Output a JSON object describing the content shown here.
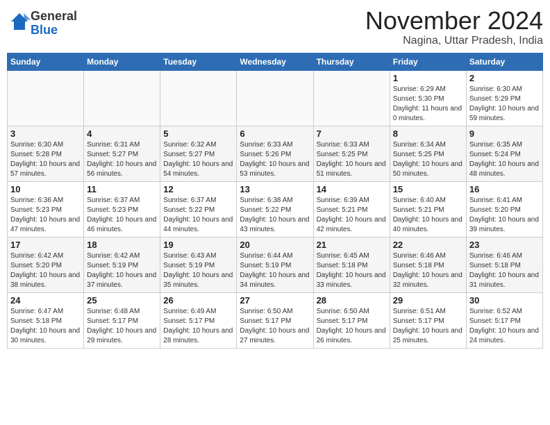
{
  "logo": {
    "general": "General",
    "blue": "Blue"
  },
  "title": "November 2024",
  "subtitle": "Nagina, Uttar Pradesh, India",
  "days_header": [
    "Sunday",
    "Monday",
    "Tuesday",
    "Wednesday",
    "Thursday",
    "Friday",
    "Saturday"
  ],
  "weeks": [
    [
      {
        "day": "",
        "info": ""
      },
      {
        "day": "",
        "info": ""
      },
      {
        "day": "",
        "info": ""
      },
      {
        "day": "",
        "info": ""
      },
      {
        "day": "",
        "info": ""
      },
      {
        "day": "1",
        "info": "Sunrise: 6:29 AM\nSunset: 5:30 PM\nDaylight: 11 hours and 0 minutes."
      },
      {
        "day": "2",
        "info": "Sunrise: 6:30 AM\nSunset: 5:29 PM\nDaylight: 10 hours and 59 minutes."
      }
    ],
    [
      {
        "day": "3",
        "info": "Sunrise: 6:30 AM\nSunset: 5:28 PM\nDaylight: 10 hours and 57 minutes."
      },
      {
        "day": "4",
        "info": "Sunrise: 6:31 AM\nSunset: 5:27 PM\nDaylight: 10 hours and 56 minutes."
      },
      {
        "day": "5",
        "info": "Sunrise: 6:32 AM\nSunset: 5:27 PM\nDaylight: 10 hours and 54 minutes."
      },
      {
        "day": "6",
        "info": "Sunrise: 6:33 AM\nSunset: 5:26 PM\nDaylight: 10 hours and 53 minutes."
      },
      {
        "day": "7",
        "info": "Sunrise: 6:33 AM\nSunset: 5:25 PM\nDaylight: 10 hours and 51 minutes."
      },
      {
        "day": "8",
        "info": "Sunrise: 6:34 AM\nSunset: 5:25 PM\nDaylight: 10 hours and 50 minutes."
      },
      {
        "day": "9",
        "info": "Sunrise: 6:35 AM\nSunset: 5:24 PM\nDaylight: 10 hours and 48 minutes."
      }
    ],
    [
      {
        "day": "10",
        "info": "Sunrise: 6:36 AM\nSunset: 5:23 PM\nDaylight: 10 hours and 47 minutes."
      },
      {
        "day": "11",
        "info": "Sunrise: 6:37 AM\nSunset: 5:23 PM\nDaylight: 10 hours and 46 minutes."
      },
      {
        "day": "12",
        "info": "Sunrise: 6:37 AM\nSunset: 5:22 PM\nDaylight: 10 hours and 44 minutes."
      },
      {
        "day": "13",
        "info": "Sunrise: 6:38 AM\nSunset: 5:22 PM\nDaylight: 10 hours and 43 minutes."
      },
      {
        "day": "14",
        "info": "Sunrise: 6:39 AM\nSunset: 5:21 PM\nDaylight: 10 hours and 42 minutes."
      },
      {
        "day": "15",
        "info": "Sunrise: 6:40 AM\nSunset: 5:21 PM\nDaylight: 10 hours and 40 minutes."
      },
      {
        "day": "16",
        "info": "Sunrise: 6:41 AM\nSunset: 5:20 PM\nDaylight: 10 hours and 39 minutes."
      }
    ],
    [
      {
        "day": "17",
        "info": "Sunrise: 6:42 AM\nSunset: 5:20 PM\nDaylight: 10 hours and 38 minutes."
      },
      {
        "day": "18",
        "info": "Sunrise: 6:42 AM\nSunset: 5:19 PM\nDaylight: 10 hours and 37 minutes."
      },
      {
        "day": "19",
        "info": "Sunrise: 6:43 AM\nSunset: 5:19 PM\nDaylight: 10 hours and 35 minutes."
      },
      {
        "day": "20",
        "info": "Sunrise: 6:44 AM\nSunset: 5:19 PM\nDaylight: 10 hours and 34 minutes."
      },
      {
        "day": "21",
        "info": "Sunrise: 6:45 AM\nSunset: 5:18 PM\nDaylight: 10 hours and 33 minutes."
      },
      {
        "day": "22",
        "info": "Sunrise: 6:46 AM\nSunset: 5:18 PM\nDaylight: 10 hours and 32 minutes."
      },
      {
        "day": "23",
        "info": "Sunrise: 6:46 AM\nSunset: 5:18 PM\nDaylight: 10 hours and 31 minutes."
      }
    ],
    [
      {
        "day": "24",
        "info": "Sunrise: 6:47 AM\nSunset: 5:18 PM\nDaylight: 10 hours and 30 minutes."
      },
      {
        "day": "25",
        "info": "Sunrise: 6:48 AM\nSunset: 5:17 PM\nDaylight: 10 hours and 29 minutes."
      },
      {
        "day": "26",
        "info": "Sunrise: 6:49 AM\nSunset: 5:17 PM\nDaylight: 10 hours and 28 minutes."
      },
      {
        "day": "27",
        "info": "Sunrise: 6:50 AM\nSunset: 5:17 PM\nDaylight: 10 hours and 27 minutes."
      },
      {
        "day": "28",
        "info": "Sunrise: 6:50 AM\nSunset: 5:17 PM\nDaylight: 10 hours and 26 minutes."
      },
      {
        "day": "29",
        "info": "Sunrise: 6:51 AM\nSunset: 5:17 PM\nDaylight: 10 hours and 25 minutes."
      },
      {
        "day": "30",
        "info": "Sunrise: 6:52 AM\nSunset: 5:17 PM\nDaylight: 10 hours and 24 minutes."
      }
    ]
  ]
}
